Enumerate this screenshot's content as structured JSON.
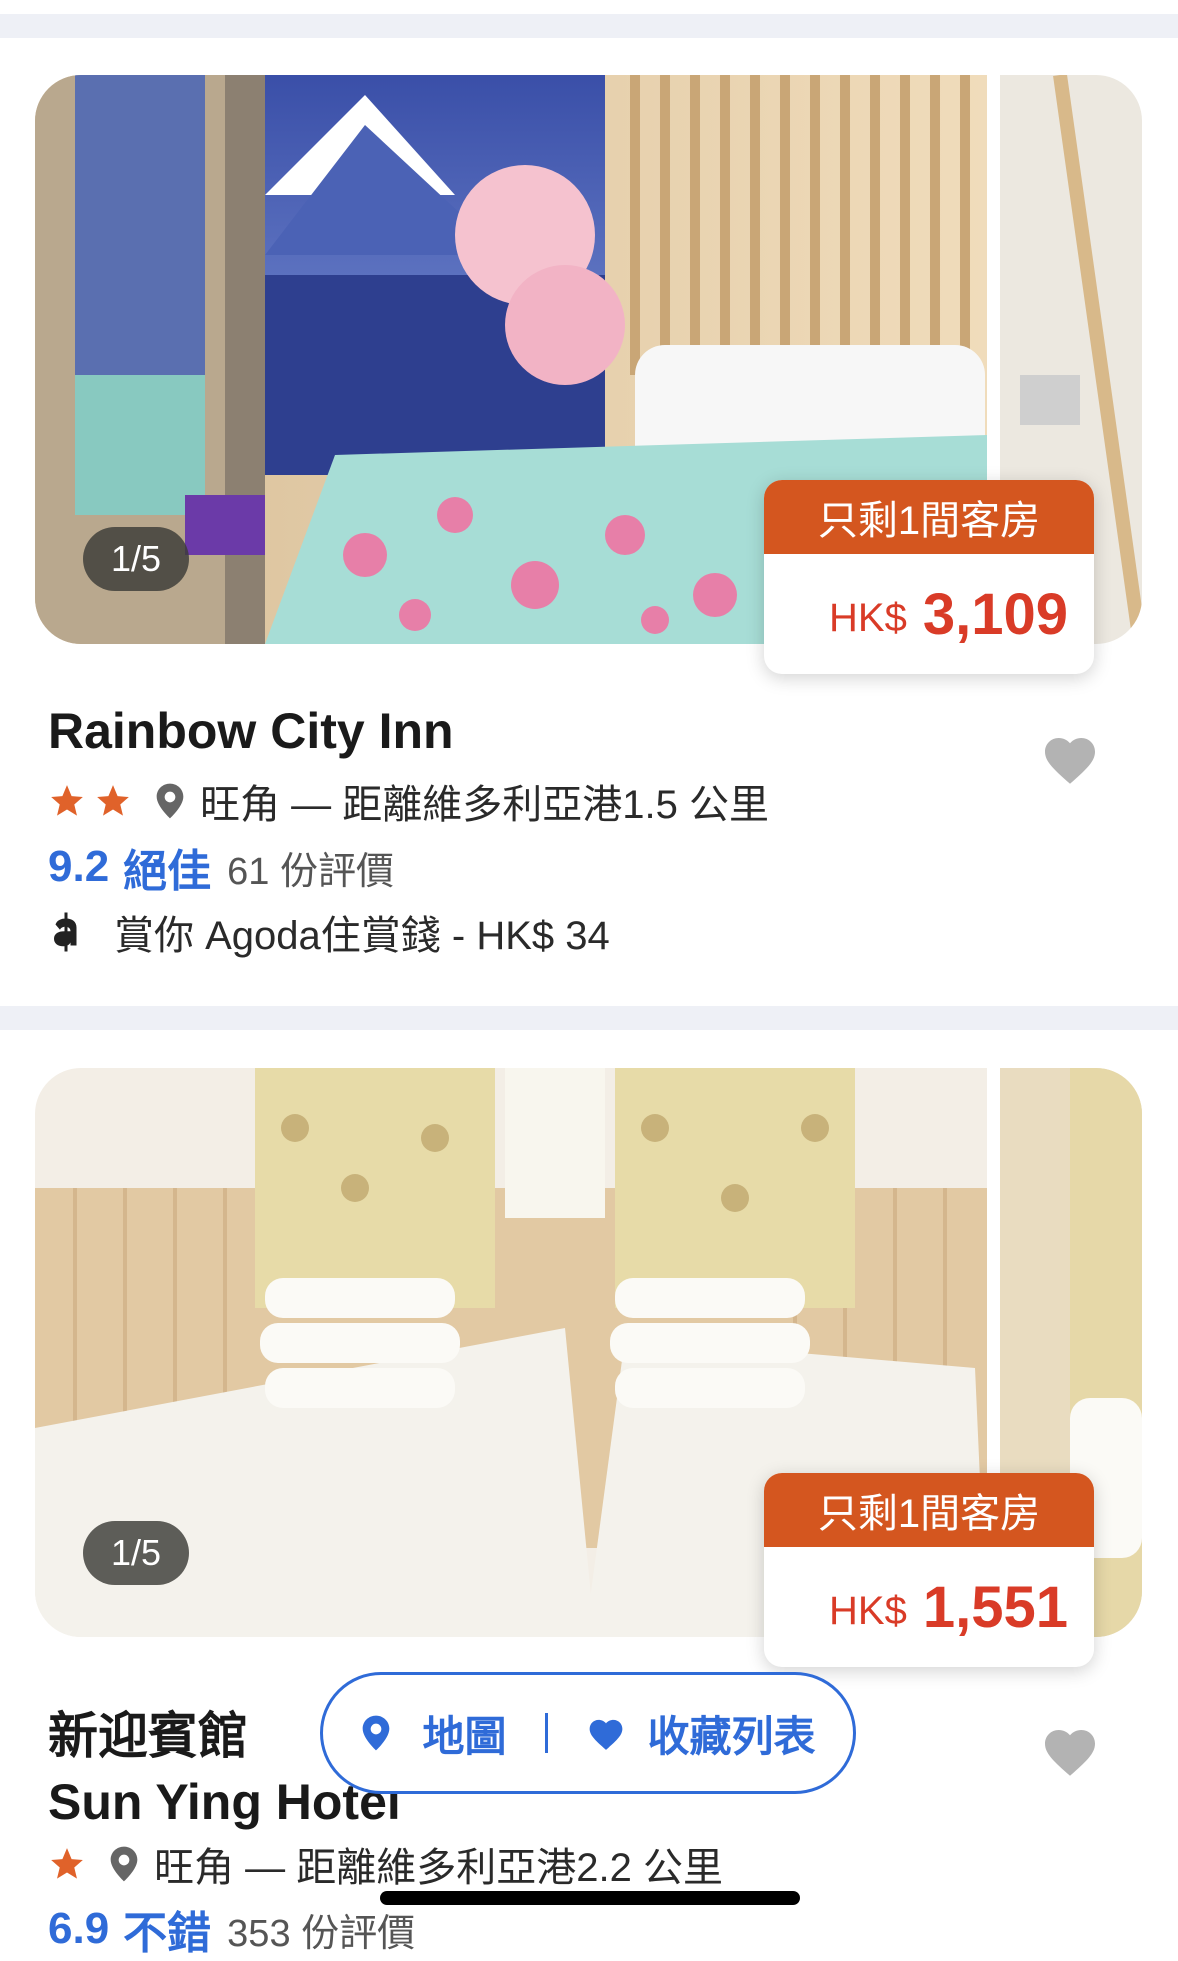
{
  "listings": [
    {
      "photo_counter": "1/5",
      "urgency": "只剩1間客房",
      "currency": "HK$",
      "price": "3,109",
      "title_zh": "",
      "title": "Rainbow City Inn",
      "stars": 2,
      "location": "旺角 — 距離維多利亞港1.5 公里",
      "score": "9.2",
      "score_label": "絕佳",
      "review_count": "61 份評價",
      "reward": "賞你 Agoda住賞錢 - HK$ 34"
    },
    {
      "photo_counter": "1/5",
      "urgency": "只剩1間客房",
      "currency": "HK$",
      "price": "1,551",
      "title_zh": "新迎賓館",
      "title": "Sun Ying Hotel",
      "stars": 1,
      "location": "旺角 — 距離維多利亞港2.2 公里",
      "score": "6.9",
      "score_label": "不錯",
      "review_count": "353 份評價"
    }
  ],
  "floating_bar": {
    "map_label": "地圖",
    "favorites_label": "收藏列表"
  },
  "colors": {
    "accent_blue": "#2f6bd8",
    "price_red": "#d93b27",
    "urgent_orange": "#d4561f",
    "star_orange": "#e0622a",
    "separator": "#eef0f6"
  },
  "icons": [
    "heart-icon",
    "location-pin-icon",
    "star-icon",
    "agoda-cash-icon"
  ]
}
